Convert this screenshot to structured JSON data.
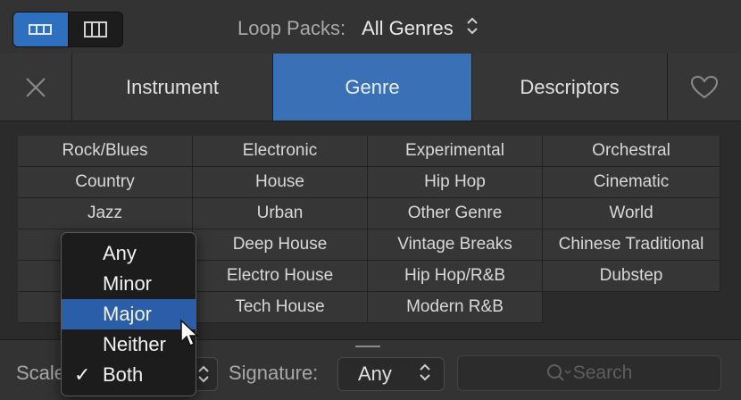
{
  "header": {
    "loop_packs_label": "Loop Packs:",
    "loop_packs_value": "All Genres"
  },
  "tabs": [
    {
      "label": ""
    },
    {
      "label": "Instrument"
    },
    {
      "label": "Genre"
    },
    {
      "label": "Descriptors"
    },
    {
      "label": ""
    }
  ],
  "tags": [
    [
      "Rock/Blues",
      "Electronic",
      "Experimental",
      "Orchestral"
    ],
    [
      "Country",
      "House",
      "Hip Hop",
      "Cinematic"
    ],
    [
      "Jazz",
      "Urban",
      "Other Genre",
      "World"
    ],
    [
      "",
      "Deep House",
      "Vintage Breaks",
      "Chinese Traditional"
    ],
    [
      "",
      "Electro House",
      "Hip Hop/R&B",
      "Dubstep"
    ],
    [
      "",
      "Tech House",
      "Modern R&B",
      ""
    ]
  ],
  "footer": {
    "scale_label": "Scale",
    "signature_label": "Signature:",
    "signature_value": "Any",
    "search_placeholder": "Search"
  },
  "scale_menu": {
    "items": [
      "Any",
      "Minor",
      "Major",
      "Neither",
      "Both"
    ],
    "highlighted": "Major",
    "checked": "Both"
  },
  "colors": {
    "accent": "#3a70b5",
    "highlight": "#2b5ea8"
  }
}
